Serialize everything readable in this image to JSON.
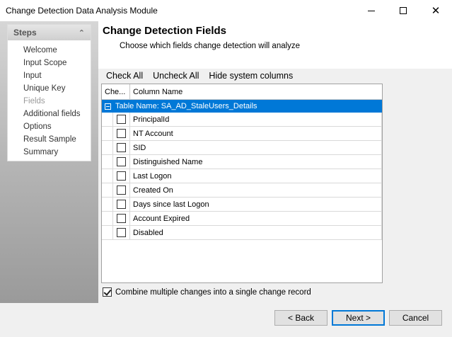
{
  "window": {
    "title": "Change Detection Data Analysis Module",
    "min_icon": "minimize-icon",
    "max_icon": "maximize-icon",
    "close_icon": "close-icon",
    "close_glyph": "✕"
  },
  "steps": {
    "header": "Steps",
    "collapse_glyph": "⌃",
    "items": [
      {
        "label": "Welcome",
        "current": false
      },
      {
        "label": "Input Scope",
        "current": false
      },
      {
        "label": "Input",
        "current": false
      },
      {
        "label": "Unique Key",
        "current": false
      },
      {
        "label": "Fields",
        "current": true
      },
      {
        "label": "Additional fields",
        "current": false
      },
      {
        "label": "Options",
        "current": false
      },
      {
        "label": "Result Sample",
        "current": false
      },
      {
        "label": "Summary",
        "current": false
      }
    ]
  },
  "page": {
    "title": "Change Detection Fields",
    "subtitle": "Choose which fields change detection will analyze"
  },
  "toolbar": {
    "check_all": "Check All",
    "uncheck_all": "Uncheck All",
    "hide_system": "Hide system columns"
  },
  "grid": {
    "col_check": "Che...",
    "col_name": "Column Name",
    "group_label": "Table Name: SA_AD_StaleUsers_Details",
    "rows": [
      {
        "name": "PrincipalId",
        "checked": false
      },
      {
        "name": "NT Account",
        "checked": false
      },
      {
        "name": "SID",
        "checked": false
      },
      {
        "name": "Distinguished Name",
        "checked": false
      },
      {
        "name": "Last Logon",
        "checked": false
      },
      {
        "name": "Created On",
        "checked": false
      },
      {
        "name": "Days since last Logon",
        "checked": false
      },
      {
        "name": "Account Expired",
        "checked": false
      },
      {
        "name": "Disabled",
        "checked": false
      }
    ]
  },
  "options": {
    "combine_label": "Combine multiple changes into a single change record",
    "combine_checked": true
  },
  "buttons": {
    "back": "< Back",
    "next": "Next >",
    "cancel": "Cancel"
  }
}
